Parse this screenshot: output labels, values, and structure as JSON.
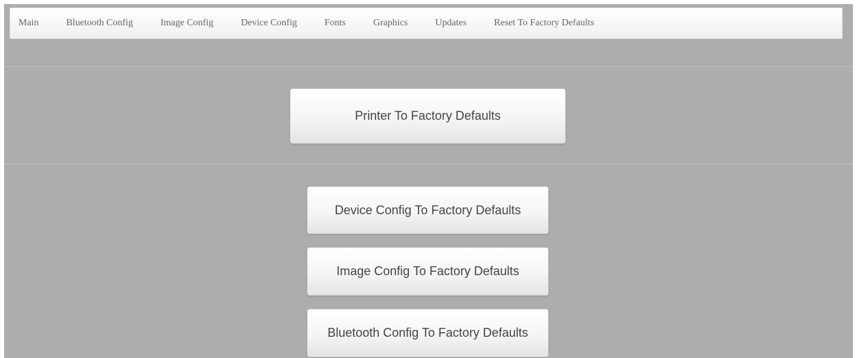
{
  "nav": {
    "items": [
      {
        "label": "Main"
      },
      {
        "label": "Bluetooth Config"
      },
      {
        "label": "Image Config"
      },
      {
        "label": "Device Config"
      },
      {
        "label": "Fonts"
      },
      {
        "label": "Graphics"
      },
      {
        "label": "Updates"
      },
      {
        "label": "Reset To Factory Defaults"
      }
    ]
  },
  "actions": {
    "printer_label": "Printer To Factory Defaults",
    "device_label": "Device Config To Factory Defaults",
    "image_label": "Image Config To Factory Defaults",
    "bluetooth_label": "Bluetooth Config To Factory Defaults"
  },
  "colors": {
    "background": "#adadad",
    "navbar": "#f7f7f7",
    "button_text": "#444444"
  }
}
